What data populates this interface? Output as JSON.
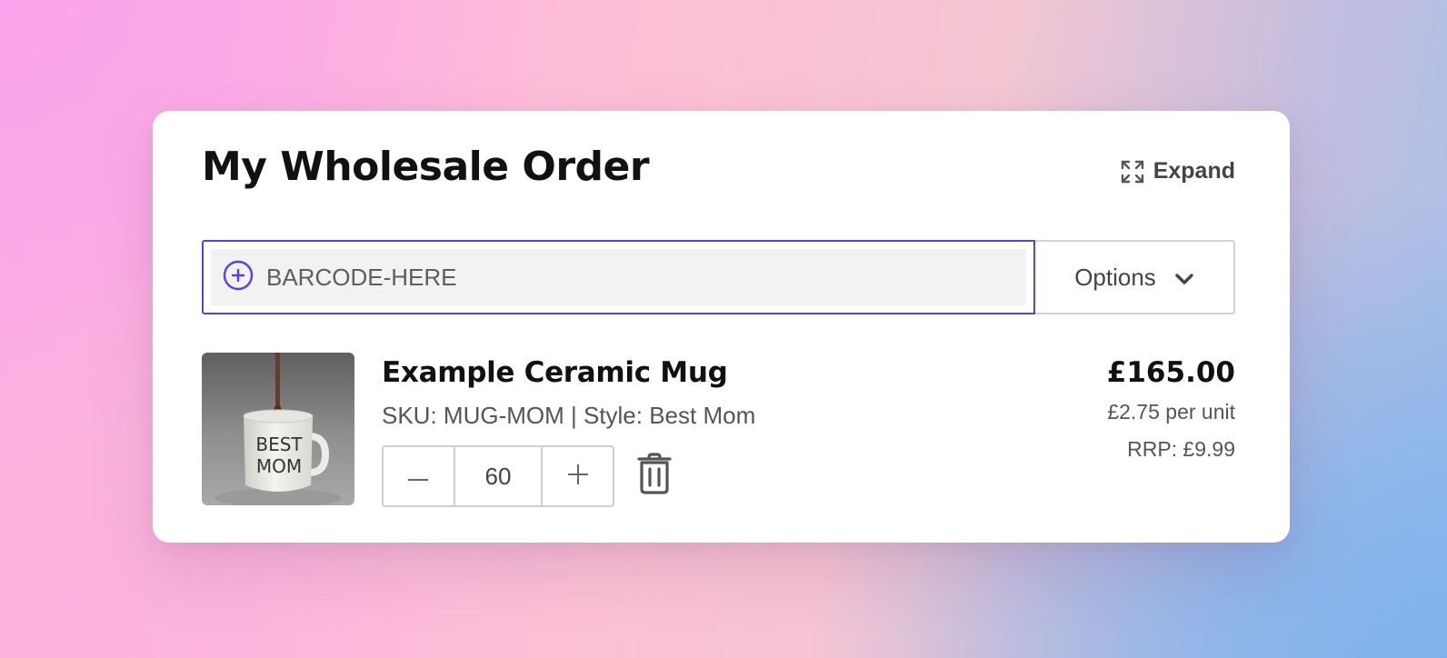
{
  "order": {
    "title": "My Wholesale Order",
    "expand_label": "Expand"
  },
  "barcode": {
    "placeholder": "BARCODE-HERE",
    "options_label": "Options"
  },
  "items": [
    {
      "name": "Example Ceramic Mug",
      "meta": "SKU: MUG-MOM | Style: Best Mom",
      "quantity": "60",
      "total": "£165.00",
      "unit_price": "£2.75 per unit",
      "rrp": "RRP: £9.99",
      "mug_text_line1": "BEST",
      "mug_text_line2": "MOM"
    }
  ],
  "colors": {
    "accent": "#5a3fe4",
    "text_primary": "#111111",
    "text_secondary": "#555555",
    "border": "#d0d0d0"
  },
  "icons": {
    "expand": "expand-arrows-icon",
    "add": "plus-circle-icon",
    "options": "chevron-down-icon",
    "decrement": "minus-icon",
    "increment": "plus-icon",
    "delete": "trash-icon"
  }
}
